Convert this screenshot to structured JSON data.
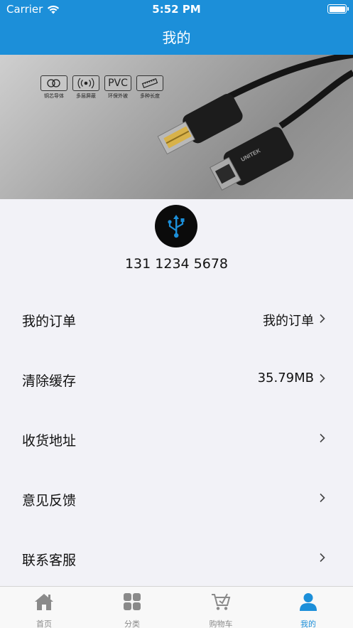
{
  "status_bar": {
    "carrier": "Carrier",
    "time": "5:52 PM"
  },
  "header": {
    "title": "我的"
  },
  "banner": {
    "badges": [
      {
        "icon": "copper-core-icon",
        "text": "",
        "caption": "铜芯导体"
      },
      {
        "icon": "signal-shield-icon",
        "text": "",
        "caption": "多层屏蔽"
      },
      {
        "icon": "pvc-text",
        "text": "PVC",
        "caption": "环保外被"
      },
      {
        "icon": "ruler-icon",
        "text": "",
        "caption": "多种长度"
      }
    ],
    "brand_text": "UNITEK"
  },
  "profile": {
    "avatar_icon": "usb-icon",
    "phone": "131 1234 5678"
  },
  "menu": [
    {
      "label": "我的订单",
      "value": "我的订单"
    },
    {
      "label": "清除缓存",
      "value": "35.79MB"
    },
    {
      "label": "收货地址",
      "value": ""
    },
    {
      "label": "意见反馈",
      "value": ""
    },
    {
      "label": "联系客服",
      "value": ""
    }
  ],
  "tabbar": {
    "items": [
      {
        "label": "首页",
        "icon": "home-icon"
      },
      {
        "label": "分类",
        "icon": "grid-icon"
      },
      {
        "label": "购物车",
        "icon": "cart-icon"
      },
      {
        "label": "我的",
        "icon": "user-icon"
      }
    ],
    "active_index": 3
  },
  "colors": {
    "primary": "#1c8fd9",
    "background": "#f2f2f7",
    "inactive": "#8a8a8a"
  }
}
